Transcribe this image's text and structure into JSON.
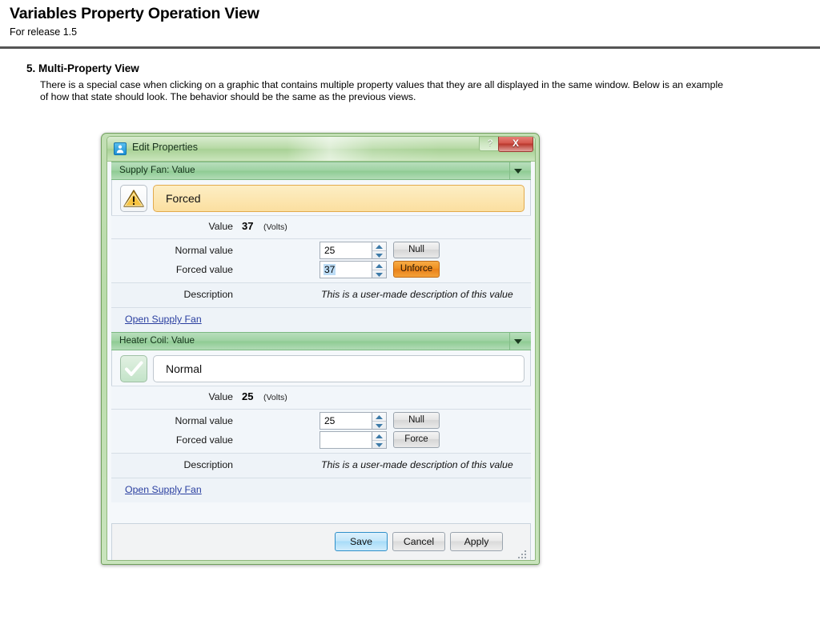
{
  "document": {
    "title": "Variables Property Operation View",
    "subtitle": "For release 1.5",
    "section_heading": "5. Multi-Property View",
    "paragraph": "There is a special case when clicking on a graphic that contains multiple property values that they are all displayed in the same window. Below is an example of how that state should look. The behavior should be the same as the previous views."
  },
  "dialog": {
    "title": "Edit Properties",
    "icon": "person-badge-icon",
    "help_label": "?",
    "close_label": "X",
    "colors": {
      "frame": "#b9dcaa",
      "group_header": "#9ed2a2",
      "forced_field": "#fbdfa0",
      "unforce_button": "#ef9020",
      "default_button": "#a8dcf8",
      "link": "#2a3fa0"
    },
    "sections": [
      {
        "header": "Supply Fan: Value",
        "status_icon": "warning-triangle-icon",
        "status_text": "Forced",
        "status_kind": "forced",
        "value_label": "Value",
        "value_number": "37",
        "value_unit": "(Volts)",
        "normal_label": "Normal value",
        "normal_value": "25",
        "normal_button": "Null",
        "forced_label": "Forced value",
        "forced_value": "37",
        "forced_value_selected": true,
        "forced_button": "Unforce",
        "forced_button_accent": true,
        "description_label": "Description",
        "description_text": "This is a user-made description of this value",
        "link_text": "Open Supply Fan"
      },
      {
        "header": "Heater Coil: Value",
        "status_icon": "check-mark-icon",
        "status_text": "Normal",
        "status_kind": "normal",
        "value_label": "Value",
        "value_number": "25",
        "value_unit": "(Volts)",
        "normal_label": "Normal value",
        "normal_value": "25",
        "normal_button": "Null",
        "forced_label": "Forced value",
        "forced_value": "",
        "forced_value_selected": false,
        "forced_button": "Force",
        "forced_button_accent": false,
        "description_label": "Description",
        "description_text": "This is a user-made description of this value",
        "link_text": "Open Supply Fan"
      }
    ],
    "footer": {
      "save_label": "Save",
      "cancel_label": "Cancel",
      "apply_label": "Apply"
    }
  }
}
